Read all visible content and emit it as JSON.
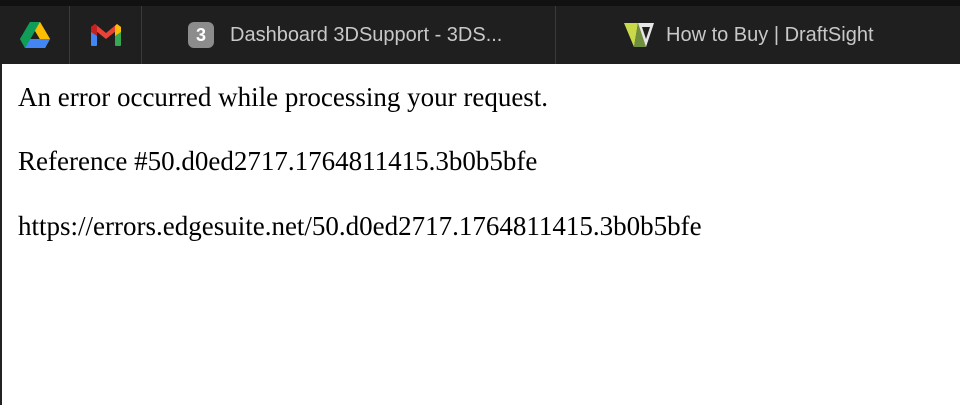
{
  "tabs": {
    "pinned": [
      {
        "icon": "google-drive-icon"
      },
      {
        "icon": "gmail-icon"
      }
    ],
    "items": [
      {
        "favicon_text": "3",
        "title": "Dashboard 3DSupport - 3DS..."
      },
      {
        "favicon": "draftsight-icon",
        "title": "How to Buy | DraftSight"
      }
    ]
  },
  "page": {
    "message": "An error occurred while processing your request.",
    "reference": "Reference #50.d0ed2717.1764811415.3b0b5bfe",
    "url": "https://errors.edgesuite.net/50.d0ed2717.1764811415.3b0b5bfe"
  },
  "colors": {
    "tabbar_bg": "#1f1f1f",
    "tab_text": "#c8c8c8",
    "page_bg": "#ffffff"
  }
}
